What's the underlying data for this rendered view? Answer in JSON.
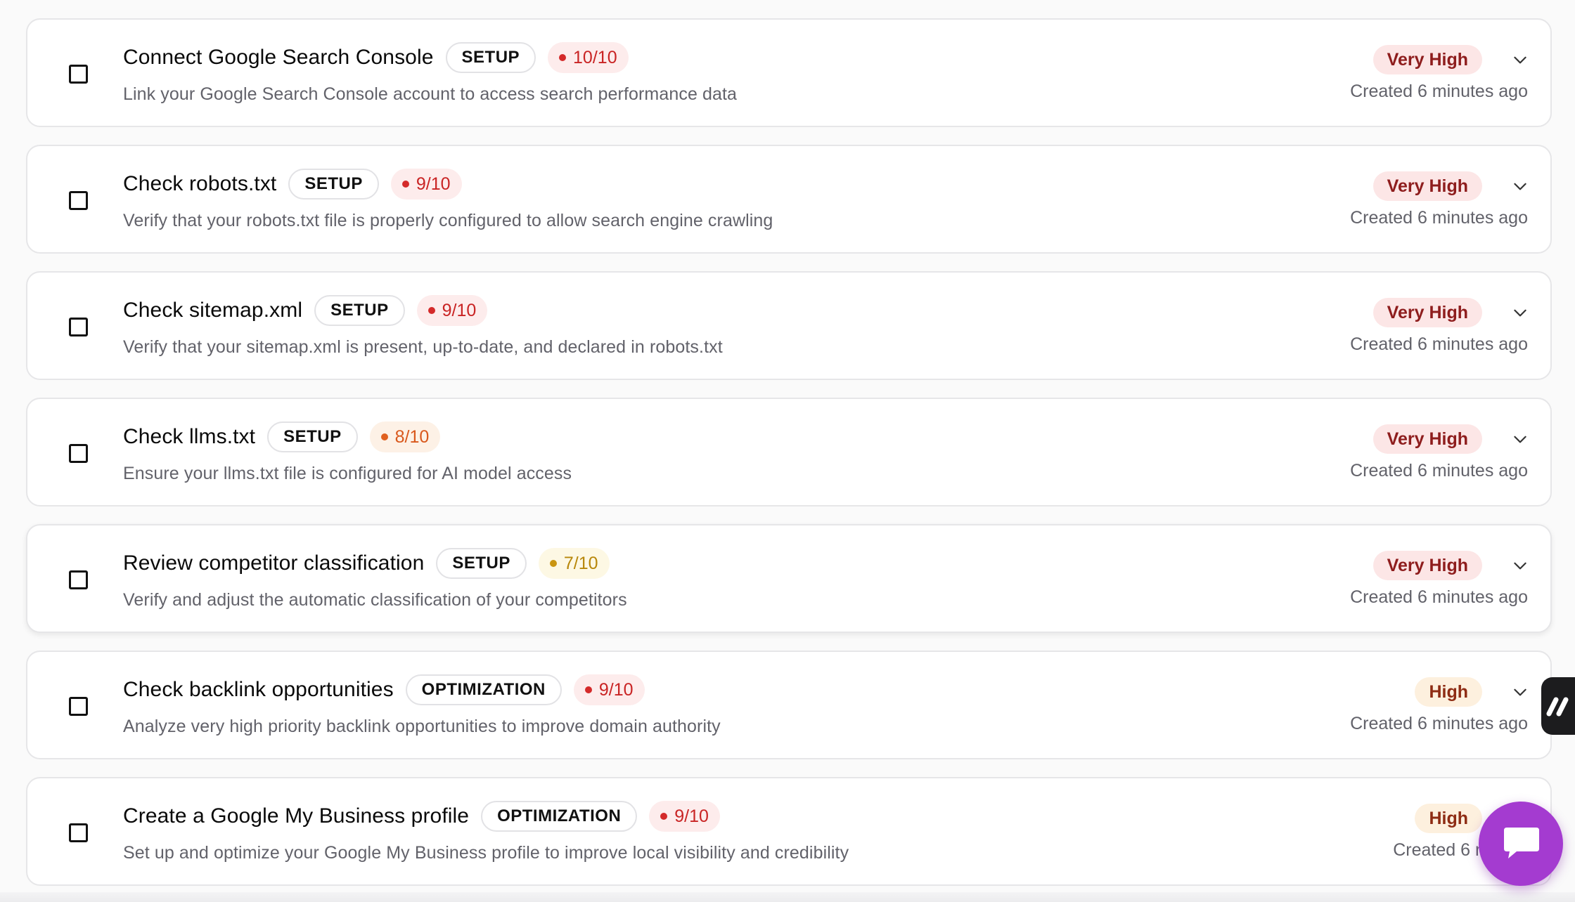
{
  "tasks": [
    {
      "title": "Connect Google Search Console",
      "category": "SETUP",
      "score": "10/10",
      "score_level": "red",
      "description": "Link your Google Search Console account to access search performance data",
      "priority": "Very High",
      "created": "Created 6 minutes ago"
    },
    {
      "title": "Check robots.txt",
      "category": "SETUP",
      "score": "9/10",
      "score_level": "red",
      "description": "Verify that your robots.txt file is properly configured to allow search engine crawling",
      "priority": "Very High",
      "created": "Created 6 minutes ago"
    },
    {
      "title": "Check sitemap.xml",
      "category": "SETUP",
      "score": "9/10",
      "score_level": "red",
      "description": "Verify that your sitemap.xml is present, up-to-date, and declared in robots.txt",
      "priority": "Very High",
      "created": "Created 6 minutes ago"
    },
    {
      "title": "Check llms.txt",
      "category": "SETUP",
      "score": "8/10",
      "score_level": "orange",
      "description": "Ensure your llms.txt file is configured for AI model access",
      "priority": "Very High",
      "created": "Created 6 minutes ago"
    },
    {
      "title": "Review competitor classification",
      "category": "SETUP",
      "score": "7/10",
      "score_level": "yellow",
      "description": "Verify and adjust the automatic classification of your competitors",
      "priority": "Very High",
      "created": "Created 6 minutes ago"
    },
    {
      "title": "Check backlink opportunities",
      "category": "OPTIMIZATION",
      "score": "9/10",
      "score_level": "red",
      "description": "Analyze very high priority backlink opportunities to improve domain authority",
      "priority": "High",
      "created": "Created 6 minutes ago"
    },
    {
      "title": "Create a Google My Business profile",
      "category": "OPTIMIZATION",
      "score": "9/10",
      "score_level": "red",
      "description": "Set up and optimize your Google My Business profile to improve local visibility and credibility",
      "priority": "High",
      "created": "Created 6 minute"
    }
  ],
  "colors": {
    "very_high_bg": "#fce6e6",
    "very_high_text": "#8e1d1d",
    "high_bg": "#fdf0de",
    "high_text": "#8e2c14",
    "score_red": "#c92424",
    "score_orange": "#d9581c",
    "score_yellow": "#b8870a",
    "chat_accent": "#a43bd0"
  },
  "icons": {
    "checkbox": "checkbox-icon",
    "expand": "chevron-down-icon",
    "score_dot": "dot-icon",
    "side_tab": "brand-logo-icon",
    "chat": "chat-icon"
  }
}
